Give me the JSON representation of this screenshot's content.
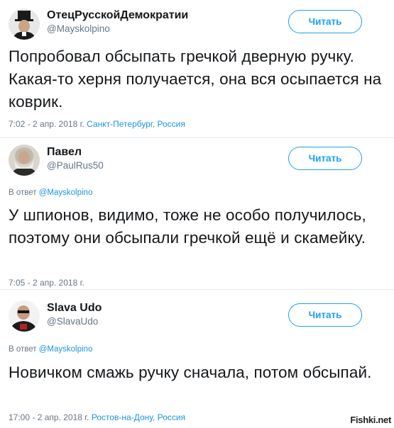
{
  "tweets": [
    {
      "name": "ОтецРусскойДемократии",
      "handle": "@Mayskolpino",
      "follow_label": "Читать",
      "reply_prefix": "",
      "reply_mention": "",
      "text": "Попробовал обсыпать гречкой дверную ручку. Какая-то херня получается, она вся осыпается на коврик.",
      "time": "7:02 - 2 апр. 2018 г.",
      "location": "Санкт-Петербург, Россия",
      "avatar": "avatar-top-hat-portrait"
    },
    {
      "name": "Павел",
      "handle": "@PaulRus50",
      "follow_label": "Читать",
      "reply_prefix": "В ответ",
      "reply_mention": "@Mayskolpino",
      "text": "У шпионов, видимо, тоже не особо получилось, поэтому они обсыпали гречкой ещё и скамейку.",
      "time": "7:05 - 2 апр. 2018 г.",
      "location": "",
      "avatar": "avatar-bearded-portrait"
    },
    {
      "name": "Slava Udo",
      "handle": "@SlavaUdo",
      "follow_label": "Читать",
      "reply_prefix": "В ответ",
      "reply_mention": "@Mayskolpino",
      "text": "Новичком смажь ручку сначала, потом обсыпай.",
      "time": "17:00 - 2 апр. 2018 г.",
      "location": "Ростов-на-Дону, Россия",
      "avatar": "avatar-person-photo"
    }
  ],
  "watermark": "Fishki.net",
  "colors": {
    "link": "#1b95e0",
    "button": "#1da1f2",
    "muted": "#657786",
    "text": "#14171a",
    "divider": "#e6ecf0"
  }
}
